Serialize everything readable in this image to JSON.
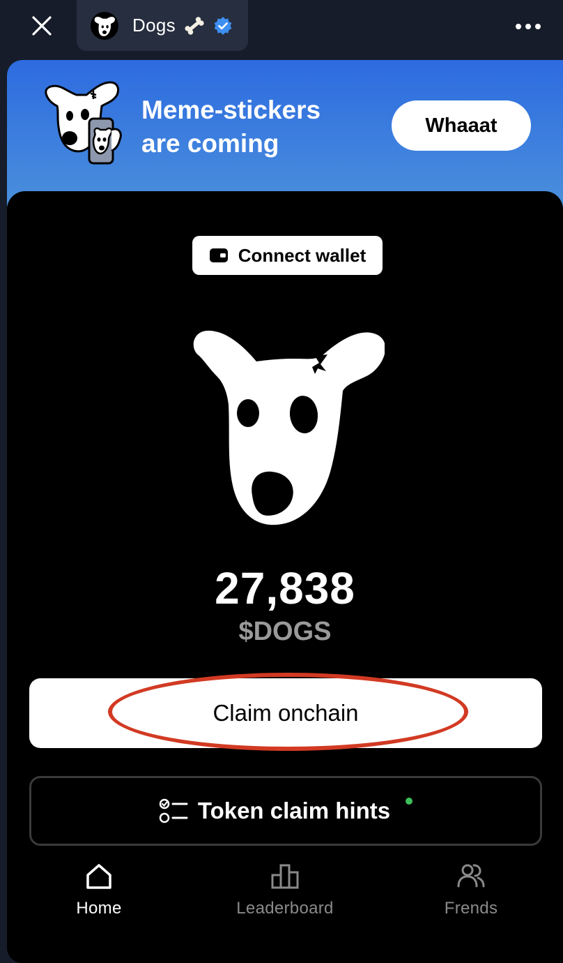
{
  "header": {
    "title": "Dogs",
    "close_icon": "close-icon",
    "more_icon": "more-dots-icon",
    "verified_icon": "verified-badge-icon",
    "bone_icon": "bone-emoji-icon"
  },
  "banner": {
    "line1": "Meme-stickers",
    "line2": "are coming",
    "button_label": "Whaaat",
    "colors": {
      "gradient_top": "#2d6be0",
      "gradient_bottom": "#4a8fdc"
    }
  },
  "wallet": {
    "label": "Connect wallet",
    "icon": "wallet-icon"
  },
  "balance": {
    "amount": "27,838",
    "currency": "$DOGS"
  },
  "actions": {
    "claim_label": "Claim onchain",
    "claim_highlight_color": "#d23a23",
    "hints_label": "Token claim hints",
    "hints_icon": "checklist-icon",
    "hints_dot_color": "#3fbf5a"
  },
  "nav": {
    "home": "Home",
    "leaderboard": "Leaderboard",
    "friends": "Frends"
  }
}
